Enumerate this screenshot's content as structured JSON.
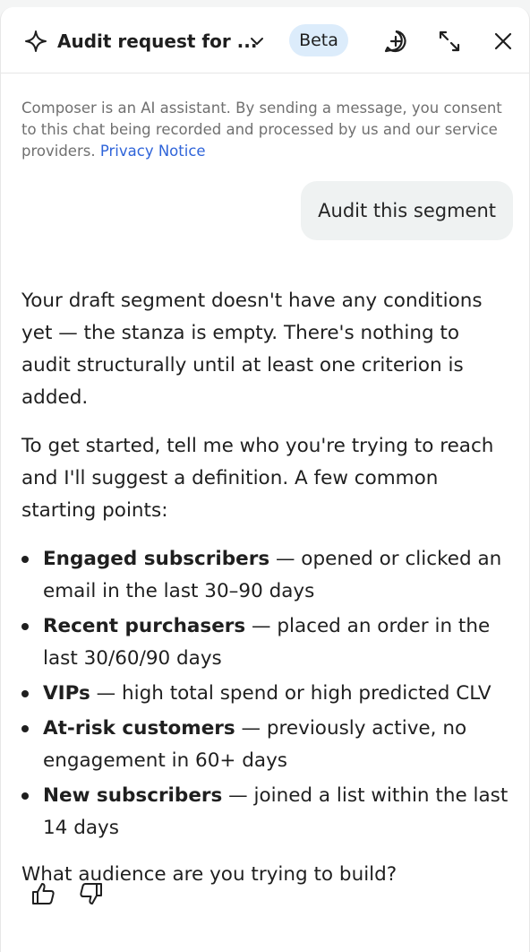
{
  "header": {
    "title": "Audit request for ...",
    "beta": "Beta"
  },
  "disclaimer": {
    "text": "Composer is an AI assistant. By sending a message, you consent to this chat being recorded and processed by us and our service providers. ",
    "link": "Privacy Notice"
  },
  "user_message": "Audit this segment",
  "assistant": {
    "p1": "Your draft segment doesn't have any conditions yet — the stanza is empty. There's nothing to audit structurally until at least one criterion is added.",
    "p2": "To get started, tell me who you're trying to reach and I'll suggest a definition. A few common starting points:",
    "items": [
      {
        "bold": "Engaged subscribers",
        "rest": " — opened or clicked an email in the last 30–90 days"
      },
      {
        "bold": "Recent purchasers",
        "rest": " — placed an order in the last 30/60/90 days"
      },
      {
        "bold": "VIPs",
        "rest": " — high total spend or high predicted CLV"
      },
      {
        "bold": "At-risk customers",
        "rest": " — previously active, no engagement in 60+ days"
      },
      {
        "bold": "New subscribers",
        "rest": " — joined a list within the last 14 days"
      }
    ],
    "closing": "What audience are you trying to build?"
  },
  "icons": {
    "sparkle": "sparkle-icon",
    "chevron": "chevron-down-icon",
    "new_chat": "new-chat-icon",
    "expand": "expand-icon",
    "close": "close-icon",
    "thumbs_up": "thumbs-up-icon",
    "thumbs_down": "thumbs-down-icon"
  },
  "colors": {
    "link": "#2f64d9",
    "beta_bg": "#dcecfb",
    "bubble_bg": "#eff2f2"
  }
}
